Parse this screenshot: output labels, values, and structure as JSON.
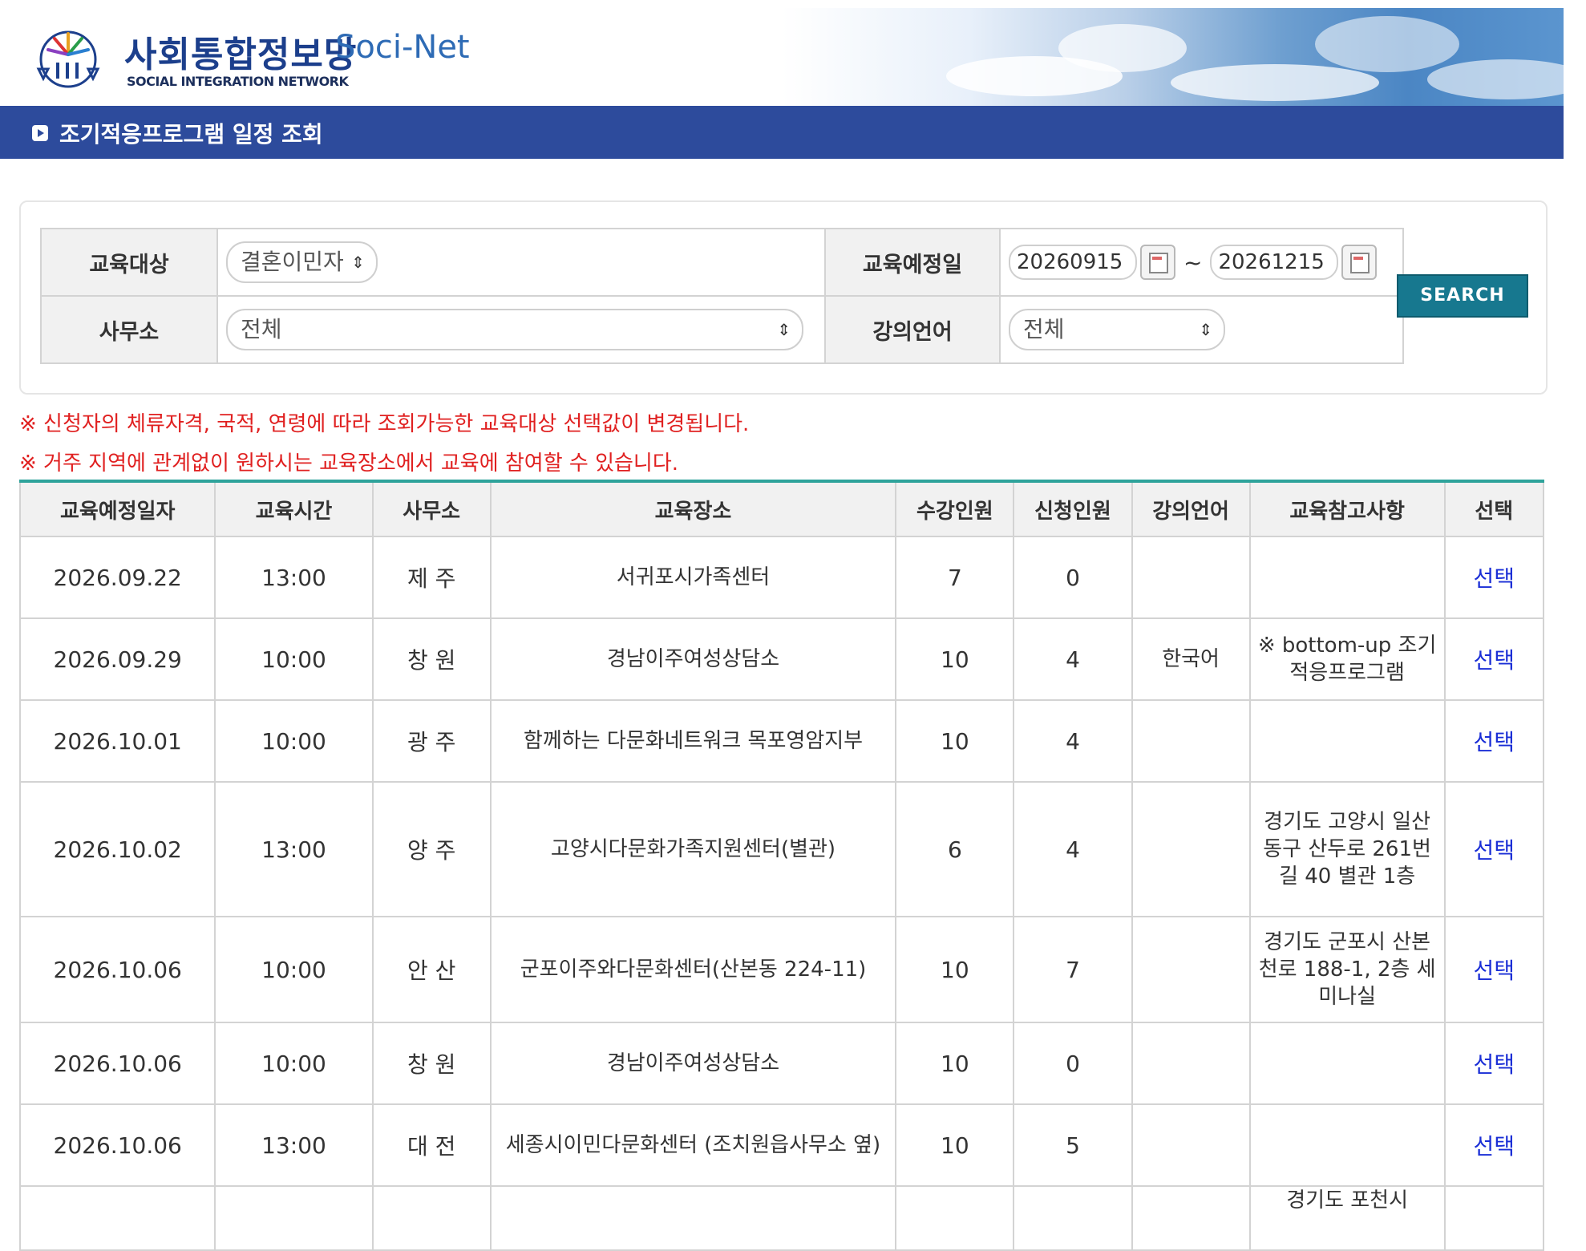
{
  "header": {
    "logo_kr": "사회통합정보망",
    "logo_en": "Soci-Net",
    "logo_sub": "SOCIAL INTEGRATION NETWORK",
    "page_title": "조기적응프로그램 일정 조회"
  },
  "search": {
    "target_label": "교육대상",
    "target_value": "결혼이민자",
    "date_label": "교육예정일",
    "date_from": "20260915",
    "date_sep": "~",
    "date_to": "20261215",
    "office_label": "사무소",
    "office_value": "전체",
    "lang_label": "강의언어",
    "lang_value": "전체",
    "search_button": "SEARCH"
  },
  "notes": [
    "※ 신청자의 체류자격, 국적, 연령에 따라 조회가능한 교육대상 선택값이 변경됩니다.",
    "※ 거주 지역에 관계없이 원하시는 교육장소에서 교육에 참여할 수 있습니다."
  ],
  "table": {
    "headers": [
      "교육예정일자",
      "교육시간",
      "사무소",
      "교육장소",
      "수강인원",
      "신청인원",
      "강의언어",
      "교육참고사항",
      "선택"
    ],
    "select_label": "선택",
    "rows": [
      {
        "date": "2026.09.22",
        "time": "13:00",
        "office": "제 주",
        "place": "서귀포시가족센터",
        "capacity": "7",
        "applied": "0",
        "lang": "",
        "note": ""
      },
      {
        "date": "2026.09.29",
        "time": "10:00",
        "office": "창 원",
        "place": "경남이주여성상담소",
        "capacity": "10",
        "applied": "4",
        "lang": "한국어",
        "note": "※ bottom-up 조기적응프로그램"
      },
      {
        "date": "2026.10.01",
        "time": "10:00",
        "office": "광 주",
        "place": "함께하는 다문화네트워크 목포영암지부",
        "capacity": "10",
        "applied": "4",
        "lang": "",
        "note": ""
      },
      {
        "date": "2026.10.02",
        "time": "13:00",
        "office": "양 주",
        "place": "고양시다문화가족지원센터(별관)",
        "capacity": "6",
        "applied": "4",
        "lang": "",
        "note": "경기도 고양시 일산동구 산두로 261번길 40 별관 1층"
      },
      {
        "date": "2026.10.06",
        "time": "10:00",
        "office": "안 산",
        "place": "군포이주와다문화센터(산본동 224-11)",
        "capacity": "10",
        "applied": "7",
        "lang": "",
        "note": "경기도 군포시 산본천로 188-1, 2층 세미나실"
      },
      {
        "date": "2026.10.06",
        "time": "10:00",
        "office": "창 원",
        "place": "경남이주여성상담소",
        "capacity": "10",
        "applied": "0",
        "lang": "",
        "note": ""
      },
      {
        "date": "2026.10.06",
        "time": "13:00",
        "office": "대 전",
        "place": "세종시이민다문화센터 (조치원읍사무소 옆)",
        "capacity": "10",
        "applied": "5",
        "lang": "",
        "note": ""
      },
      {
        "date": "",
        "time": "",
        "office": "",
        "place": "",
        "capacity": "",
        "applied": "",
        "lang": "",
        "note": "경기도 포천시"
      }
    ]
  }
}
